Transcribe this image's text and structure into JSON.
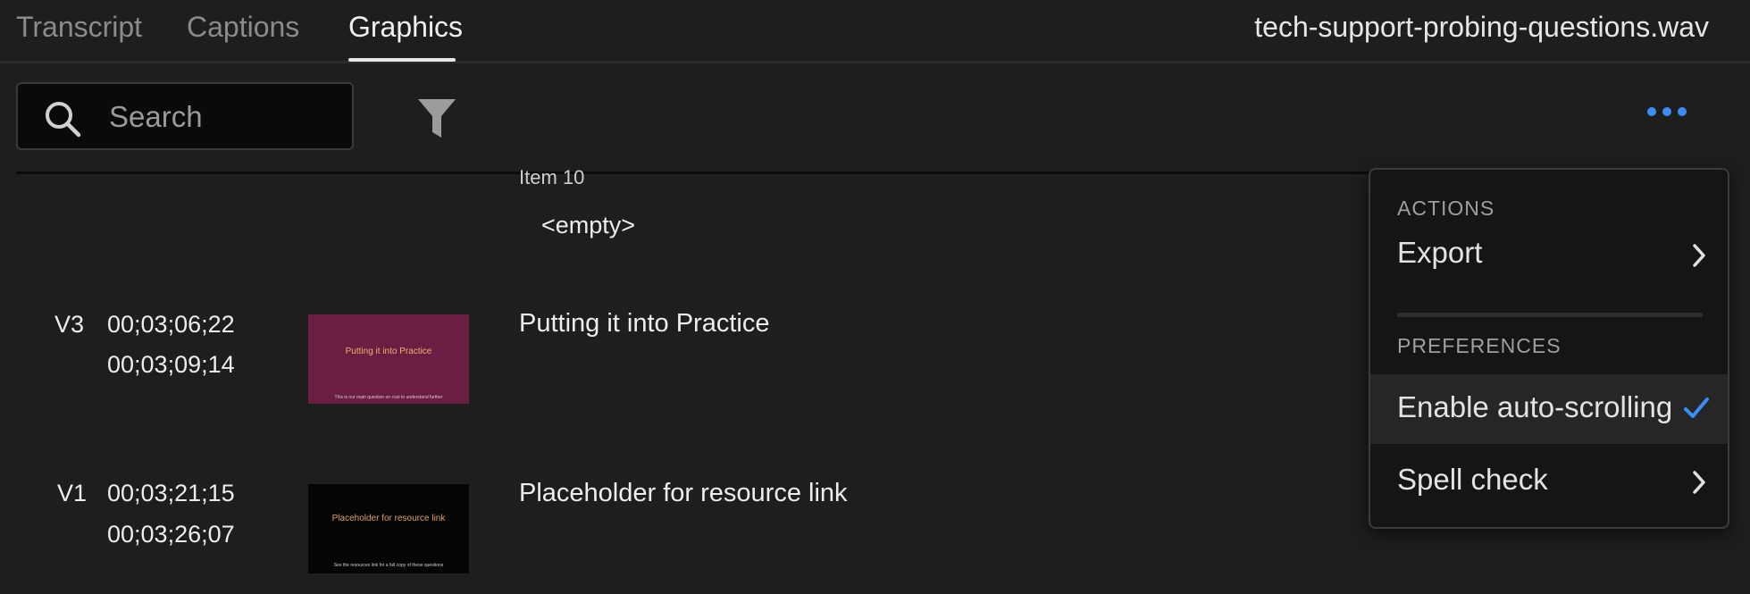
{
  "tabs": [
    {
      "label": "Transcript"
    },
    {
      "label": "Captions"
    },
    {
      "label": "Graphics"
    }
  ],
  "active_tab": "Graphics",
  "filename": "tech-support-probing-questions.wav",
  "search": {
    "placeholder": "Search",
    "value": ""
  },
  "icons": {
    "search": "search-icon",
    "filter": "filter-icon",
    "more": "more-icon",
    "chevron": "chevron-right-icon",
    "check": "checkmark-icon"
  },
  "colors": {
    "accent": "#3a8ef6",
    "background": "#1e1e1e",
    "menu_background": "#151515"
  },
  "list": {
    "partial_item": {
      "label": "Item 10",
      "value": "<empty>"
    },
    "rows": [
      {
        "track": "V3",
        "start": "00;03;06;22",
        "end": "00;03;09;14",
        "title": "Putting it into Practice",
        "thumb_text": "Putting it into Practice",
        "thumb_subtext": "This is our main question on cost to understand further",
        "thumb_bg": "#6a1f42",
        "thumb_color": "#f0b070"
      },
      {
        "track": "V1",
        "start": "00;03;21;15",
        "end": "00;03;26;07",
        "title": "Placeholder for resource link",
        "thumb_text": "Placeholder for resource link",
        "thumb_subtext": "See the resources link for a full copy of these questions",
        "thumb_bg": "#050505",
        "thumb_color": "#e0a060"
      }
    ]
  },
  "menu": {
    "actions_heading": "ACTIONS",
    "export_label": "Export",
    "preferences_heading": "PREFERENCES",
    "auto_scroll_label": "Enable auto-scrolling",
    "auto_scroll_checked": true,
    "spell_check_label": "Spell check"
  }
}
